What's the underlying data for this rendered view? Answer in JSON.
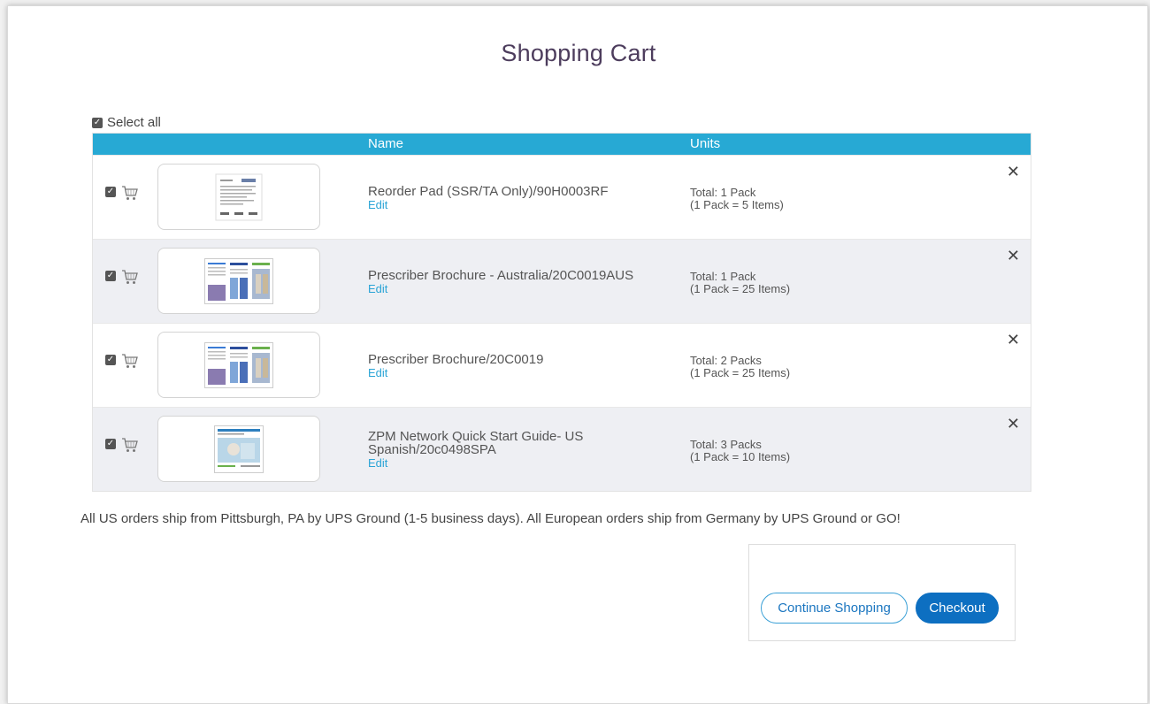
{
  "page": {
    "title": "Shopping Cart"
  },
  "select_all": {
    "label": "Select all",
    "checked": true
  },
  "table": {
    "headers": {
      "name": "Name",
      "units": "Units"
    },
    "rows": [
      {
        "name": "Reorder Pad (SSR/TA Only)/90H0003RF",
        "edit": "Edit",
        "units_total": "Total: 1 Pack",
        "units_pack": "(1 Pack = 5 Items)",
        "remove": "✕",
        "thumb": "document"
      },
      {
        "name": "Prescriber Brochure - Australia/20C0019AUS",
        "edit": "Edit",
        "units_total": "Total: 1 Pack",
        "units_pack": "(1 Pack = 25 Items)",
        "remove": "✕",
        "thumb": "brochure"
      },
      {
        "name": "Prescriber Brochure/20C0019",
        "edit": "Edit",
        "units_total": "Total: 2 Packs",
        "units_pack": "(1 Pack = 25 Items)",
        "remove": "✕",
        "thumb": "brochure"
      },
      {
        "name": "ZPM Network Quick Start Guide- US Spanish/20c0498SPA",
        "edit": "Edit",
        "units_total": "Total: 3 Packs",
        "units_pack": "(1 Pack = 10 Items)",
        "remove": "✕",
        "thumb": "guide"
      }
    ]
  },
  "shipping_note": "All US orders ship from Pittsburgh, PA by UPS Ground (1-5 business days). All European orders ship from Germany by UPS Ground or GO!",
  "actions": {
    "continue_label": "Continue Shopping",
    "checkout_label": "Checkout"
  },
  "colors": {
    "header": "#27a9d4",
    "link": "#2aa4d6",
    "checkout": "#0d6fc1",
    "title": "#4d3d5d"
  }
}
